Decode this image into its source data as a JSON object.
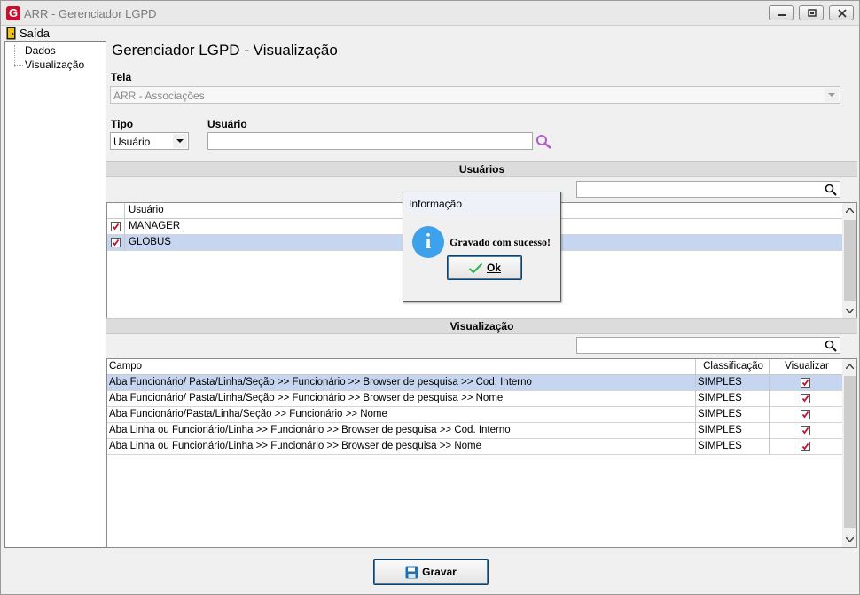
{
  "window": {
    "title": "ARR - Gerenciador LGPD",
    "logo_letter": "G"
  },
  "menu": {
    "exit_label": "Saída"
  },
  "tree": {
    "items": [
      {
        "label": "Dados"
      },
      {
        "label": "Visualização"
      }
    ]
  },
  "page_title": "Gerenciador LGPD - Visualização",
  "tela": {
    "label": "Tela",
    "value": "ARR - Associações"
  },
  "tipo": {
    "label": "Tipo",
    "value": "Usuário"
  },
  "usuario_field": {
    "label": "Usuário",
    "value": ""
  },
  "users_section": {
    "title": "Usuários",
    "column": "Usuário",
    "rows": [
      {
        "name": "MANAGER",
        "checked": true
      },
      {
        "name": "GLOBUS",
        "checked": true,
        "selected": true
      }
    ]
  },
  "visual_section": {
    "title": "Visualização",
    "columns": {
      "campo": "Campo",
      "classificacao": "Classificação",
      "visualizar": "Visualizar"
    },
    "rows": [
      {
        "campo": "Aba Funcionário/ Pasta/Linha/Seção >> Funcionário >> Browser de pesquisa >> Cod. Interno",
        "classificacao": "SIMPLES",
        "visualizar": true,
        "selected": true
      },
      {
        "campo": "Aba Funcionário/ Pasta/Linha/Seção >> Funcionário >> Browser de pesquisa >> Nome",
        "classificacao": "SIMPLES",
        "visualizar": true
      },
      {
        "campo": "Aba Funcionário/Pasta/Linha/Seção >> Funcionário >> Nome",
        "classificacao": "SIMPLES",
        "visualizar": true
      },
      {
        "campo": "Aba Linha ou Funcionário/Linha >> Funcionário >> Browser de pesquisa >> Cod. Interno",
        "classificacao": "SIMPLES",
        "visualizar": true
      },
      {
        "campo": "Aba Linha ou Funcionário/Linha >> Funcionário >> Browser de pesquisa >> Nome",
        "classificacao": "SIMPLES",
        "visualizar": true
      }
    ]
  },
  "dialog": {
    "title": "Informação",
    "message": "Gravado com sucesso!",
    "ok_label": "Ok"
  },
  "save_button": {
    "label": "Gravar"
  },
  "colors": {
    "selection": "#c6d6f0",
    "check": "#c8102e",
    "info": "#3ea1ec",
    "save_icon": "#1f6fb5"
  }
}
